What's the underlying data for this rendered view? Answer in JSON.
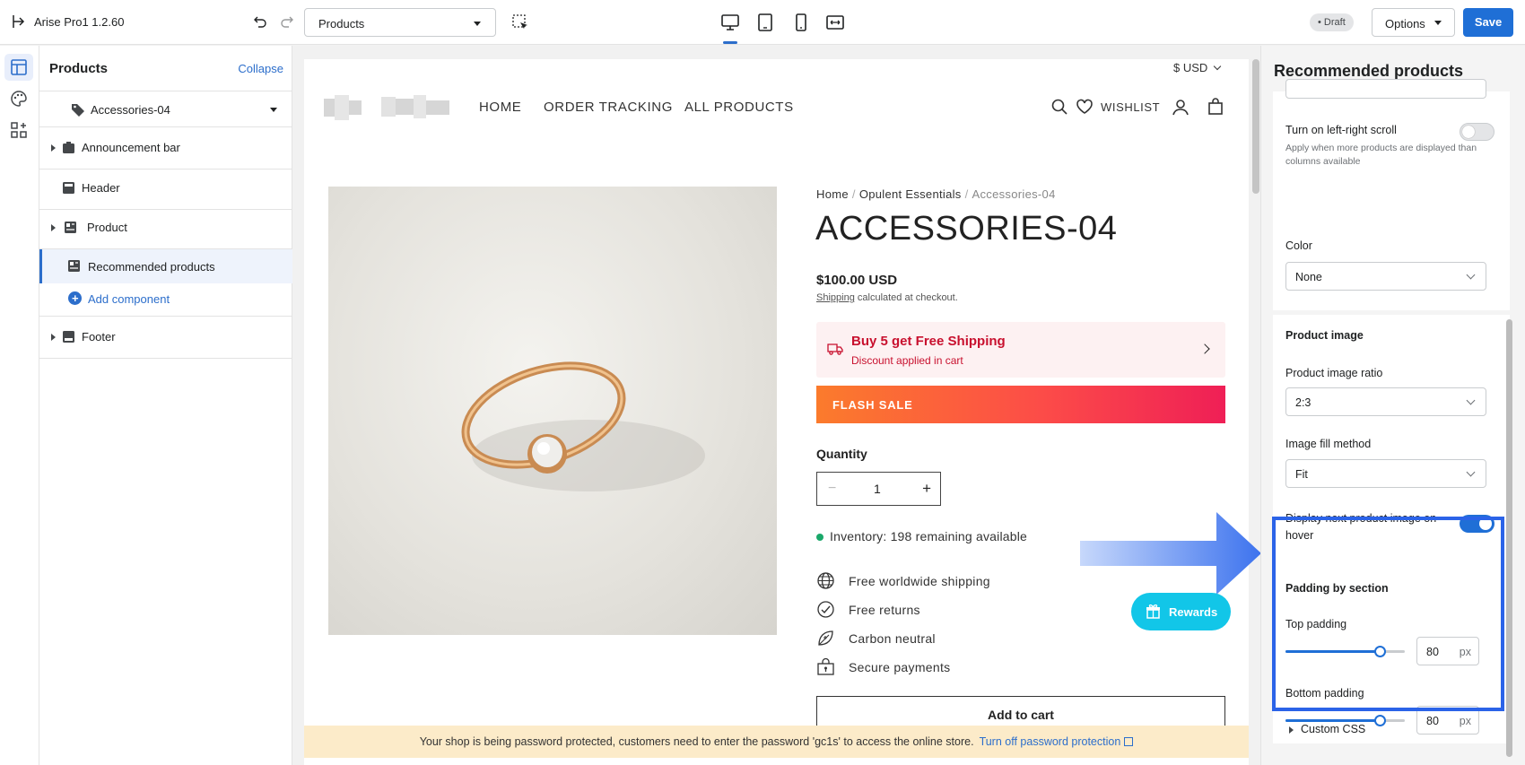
{
  "topbar": {
    "app_title": "Arise Pro1  1.2.60",
    "page_selector": "Products",
    "draft_badge": "• Draft",
    "options_label": "Options",
    "save_label": "Save"
  },
  "sidebar": {
    "title": "Products",
    "collapse_label": "Collapse",
    "product_selector": "Accessories-04",
    "items": [
      {
        "label": "Announcement bar"
      },
      {
        "label": "Header"
      },
      {
        "label": "Product"
      },
      {
        "label": "Recommended products"
      },
      {
        "label": "Footer"
      }
    ],
    "add_component_label": "Add component"
  },
  "preview": {
    "currency": "$ USD",
    "nav": [
      "HOME",
      "ORDER TRACKING",
      "ALL PRODUCTS"
    ],
    "wishlist_label": "WISHLIST",
    "breadcrumb": {
      "home": "Home",
      "collection": "Opulent Essentials",
      "current": "Accessories-04"
    },
    "product_title": "ACCESSORIES-04",
    "price": "$100.00 USD",
    "shipping_link": "Shipping",
    "shipping_rest": " calculated at checkout.",
    "promo_title": "Buy 5 get Free Shipping",
    "promo_sub": "Discount applied in cart",
    "flash_sale": "FLASH SALE",
    "quantity_label": "Quantity",
    "quantity_minus": "−",
    "quantity_value": "1",
    "quantity_plus": "+",
    "inventory": "Inventory: 198 remaining available",
    "features": [
      {
        "label": "Free worldwide shipping",
        "icon": "globe-icon"
      },
      {
        "label": "Free returns",
        "icon": "check-circle-icon"
      },
      {
        "label": "Carbon neutral",
        "icon": "leaf-icon"
      },
      {
        "label": "Secure payments",
        "icon": "lock-icon"
      }
    ],
    "add_to_cart": "Add to cart",
    "rewards_label": "Rewards",
    "password_banner": "Your shop is being password protected, customers need to enter the password 'gc1s' to access the online store.",
    "password_link": "Turn off password protection"
  },
  "panel": {
    "title": "Recommended products",
    "scroll_toggle_label": "Turn on left-right scroll",
    "scroll_toggle_help": "Apply when more products are displayed than columns available",
    "scroll_toggle_on": false,
    "color_label": "Color",
    "color_value": "None",
    "product_image_heading": "Product image",
    "image_ratio_label": "Product image ratio",
    "image_ratio_value": "2:3",
    "fill_method_label": "Image fill method",
    "fill_method_value": "Fit",
    "hover_toggle_label": "Display next product image on hover",
    "hover_toggle_on": true,
    "padding_heading": "Padding by section",
    "top_padding_label": "Top padding",
    "top_padding_value": "80",
    "bottom_padding_label": "Bottom padding",
    "bottom_padding_value": "80",
    "padding_unit": "px",
    "padding_slider_fraction": 0.8,
    "custom_css_label": "Custom CSS"
  },
  "colors": {
    "accent": "#1f6fd6",
    "promo_red": "#c8102e",
    "rewards": "#12c6e8",
    "highlight": "#2b63e8",
    "banner": "#fcebc9"
  }
}
